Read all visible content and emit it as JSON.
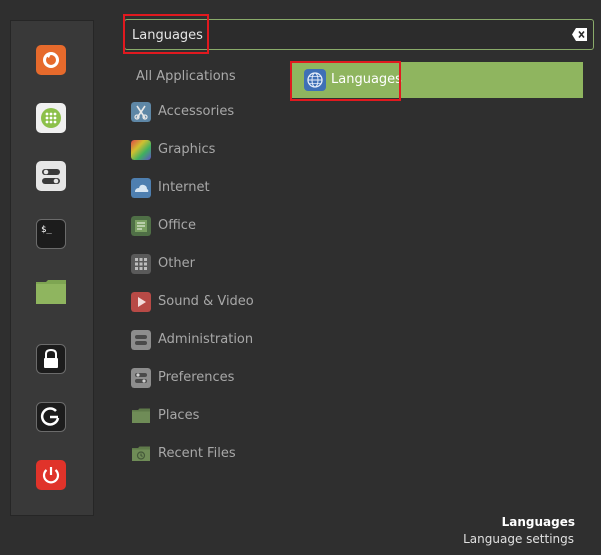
{
  "search": {
    "value": "Languages",
    "clear_icon": "backspace-icon"
  },
  "favorites": [
    {
      "name": "firefox-icon",
      "color": "#e66a2c"
    },
    {
      "name": "software-manager-icon",
      "color": "#8cc04a"
    },
    {
      "name": "settings-toggle-icon",
      "color": "#e6e6e6"
    },
    {
      "name": "terminal-icon",
      "color": "#1e1e1e"
    },
    {
      "name": "folder-icon",
      "color": "#8fb55f"
    },
    {
      "name": "lock-icon",
      "color": "#1e1e1e"
    },
    {
      "name": "logout-icon",
      "color": "#1e1e1e"
    },
    {
      "name": "power-icon",
      "color": "#e0332a"
    }
  ],
  "categories": {
    "all_label": "All Applications",
    "items": [
      {
        "label": "Accessories",
        "icon": "accessories-icon"
      },
      {
        "label": "Graphics",
        "icon": "graphics-icon"
      },
      {
        "label": "Internet",
        "icon": "internet-icon"
      },
      {
        "label": "Office",
        "icon": "office-icon"
      },
      {
        "label": "Other",
        "icon": "other-icon"
      },
      {
        "label": "Sound & Video",
        "icon": "sound-video-icon"
      },
      {
        "label": "Administration",
        "icon": "administration-icon"
      },
      {
        "label": "Preferences",
        "icon": "preferences-icon"
      },
      {
        "label": "Places",
        "icon": "places-folder-icon"
      },
      {
        "label": "Recent Files",
        "icon": "recent-files-icon"
      }
    ]
  },
  "results": [
    {
      "label": "Languages",
      "icon": "language-globe-icon"
    }
  ],
  "description": {
    "title": "Languages",
    "subtitle": "Language settings"
  },
  "colors": {
    "accent": "#8fb55f",
    "highlight_box": "#e1191f"
  }
}
